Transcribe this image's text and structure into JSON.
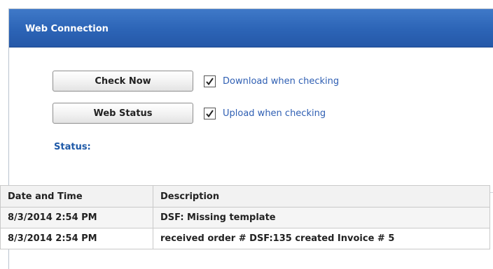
{
  "window": {
    "title": "Web Connection"
  },
  "controls": {
    "check_now_label": "Check Now",
    "web_status_label": "Web Status",
    "download_checkbox": {
      "label": "Download when checking",
      "checked": true
    },
    "upload_checkbox": {
      "label": "Upload when checking",
      "checked": true
    },
    "status_label": "Status:"
  },
  "log_table": {
    "columns": [
      "Date and Time",
      "Description"
    ],
    "rows": [
      {
        "datetime": "8/3/2014 2:54 PM",
        "description": "DSF: Missing template"
      },
      {
        "datetime": "8/3/2014 2:54 PM",
        "description": "received order # DSF:135 created Invoice # 5"
      }
    ]
  },
  "colors": {
    "titlebar": "#2c64b6",
    "link_text": "#2f5fb3",
    "status_text": "#1f5aa8"
  }
}
